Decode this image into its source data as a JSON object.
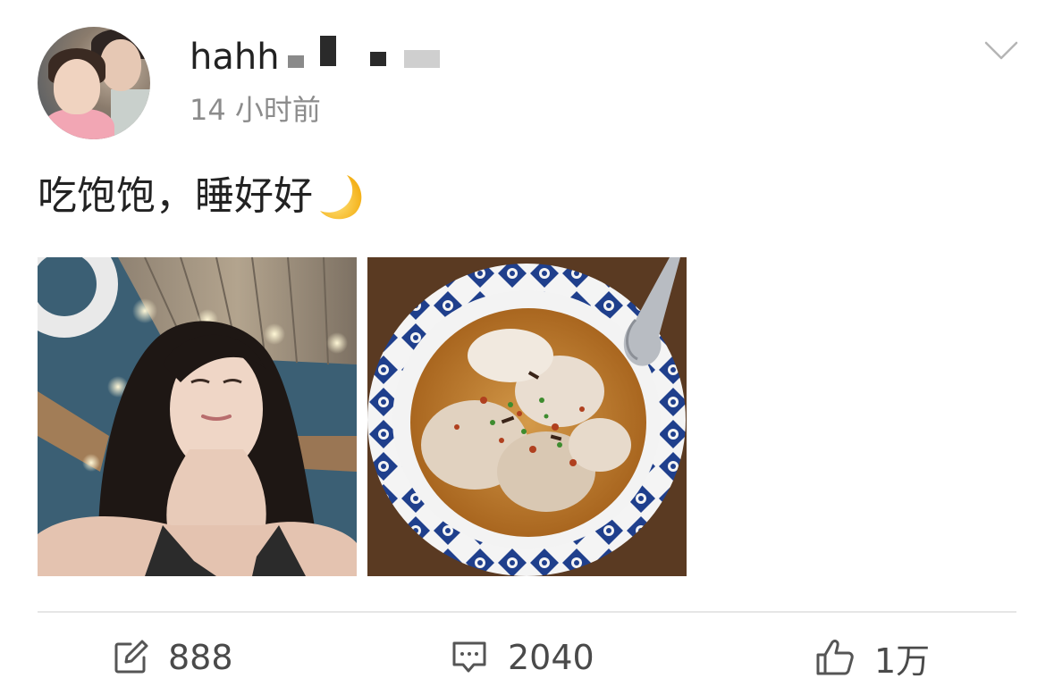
{
  "post": {
    "username": "hahh",
    "timestamp": "14 小时前",
    "text": "吃饱饱，睡好好",
    "text_emoji": "crescent-moon-emoji"
  },
  "images": [
    {
      "label": "selfie-photo"
    },
    {
      "label": "food-bowl-photo"
    }
  ],
  "actions": {
    "repost_count": "888",
    "comment_count": "2040",
    "like_count": "1万",
    "repost_icon": "repost-icon",
    "comment_icon": "comment-icon",
    "like_icon": "thumbs-up-icon"
  },
  "colors": {
    "text_primary": "#222222",
    "text_secondary": "#8c8c8c",
    "divider": "#e6e6e6"
  }
}
